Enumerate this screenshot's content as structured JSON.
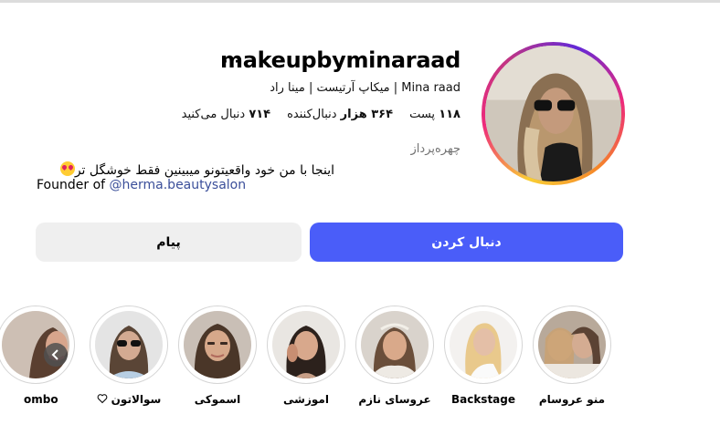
{
  "profile": {
    "username": "makeupbyminaraad",
    "more_icon": "more-horizontal-icon",
    "full_name": "Mina raad | میکاپ آرتیست | مینا راد",
    "category": "چهره‌پرداز",
    "bio_line1": "اینجا با من خود واقعیتونو میبینین فقط خوشگل تر",
    "bio_line2_prefix": "Founder of ",
    "bio_mention": "@herma.beautysalon"
  },
  "stats": {
    "posts_count": "۱۱۸",
    "posts_label": "پست",
    "followers_count": "۳۶۴ هزار",
    "followers_label": "دنبال‌کننده",
    "following_count": "۷۱۴",
    "following_label": "دنبال می‌کنید"
  },
  "buttons": {
    "follow_label": "دنبال کردن",
    "message_label": "پیام"
  },
  "colors": {
    "follow_button": "#4a5df9",
    "message_button": "#efefef",
    "mention": "#3b4f9a",
    "category_text": "#737373"
  },
  "highlights": [
    {
      "label": "منو عروسام"
    },
    {
      "label": "Backstage"
    },
    {
      "label": "عروسای نازم"
    },
    {
      "label": "اموزشی"
    },
    {
      "label": "اسموکی"
    },
    {
      "label": "سوالاتون",
      "icon": "heart-icon"
    },
    {
      "label": "ombo"
    }
  ]
}
